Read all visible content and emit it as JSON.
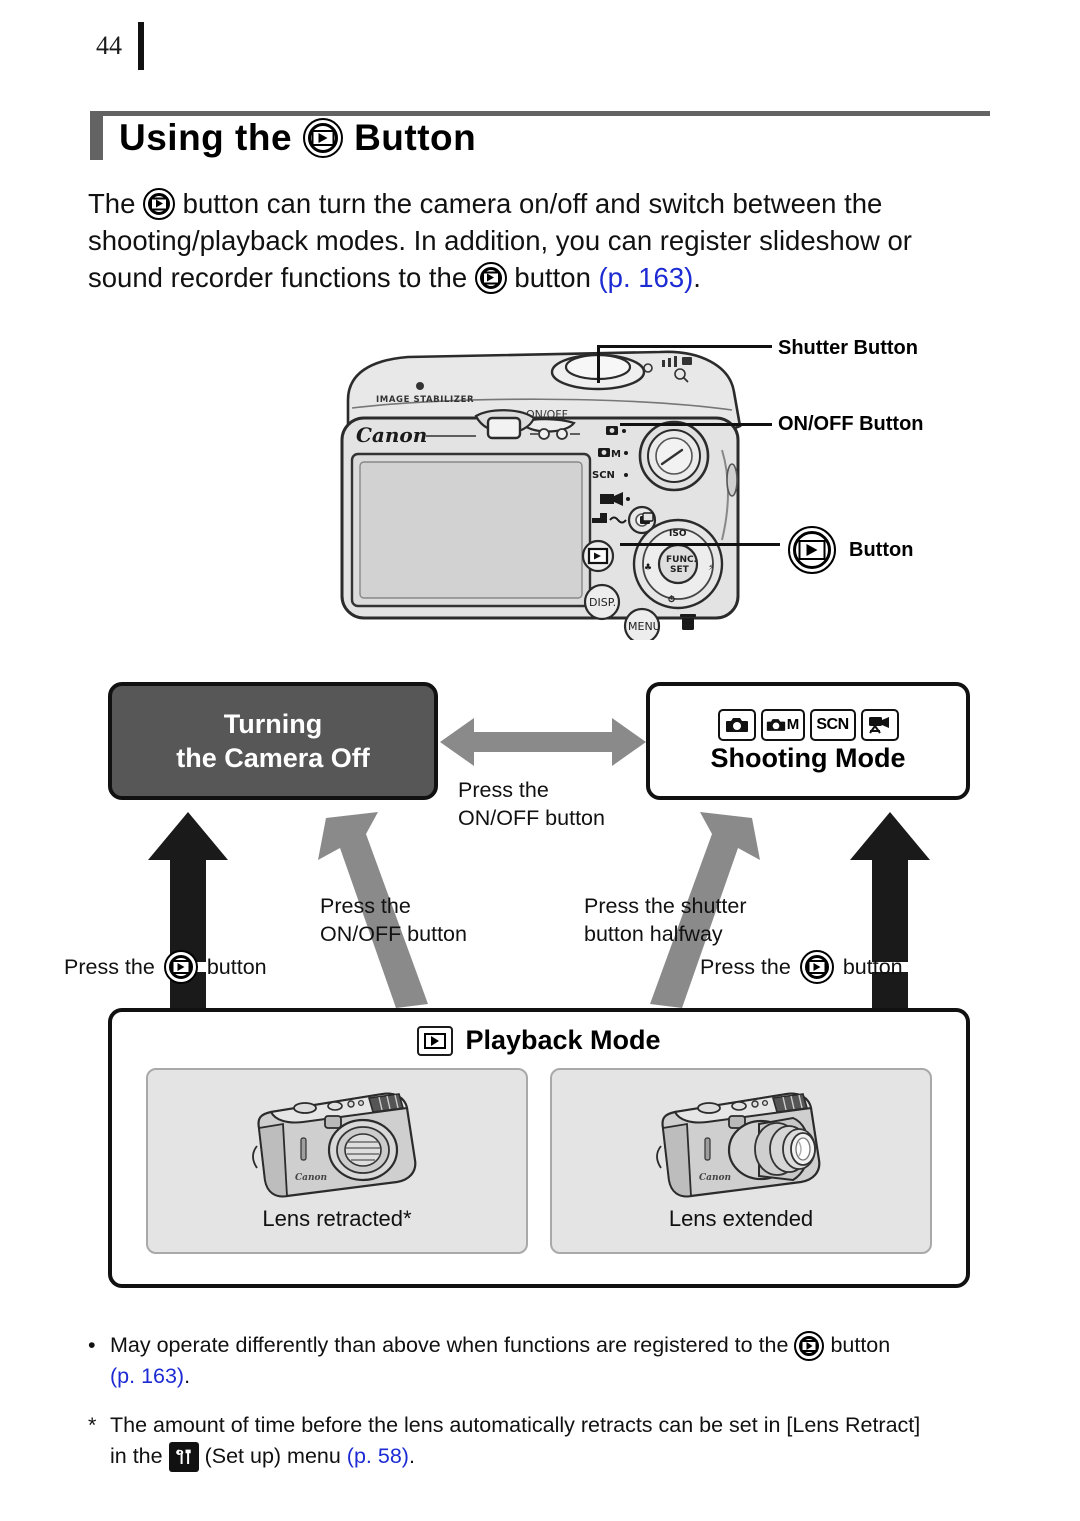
{
  "page": {
    "number": "44"
  },
  "header": {
    "title_before": "Using the",
    "title_after": "Button",
    "icon": "playback-button-icon"
  },
  "intro": {
    "line1_a": "The",
    "line1_b": "button can turn the camera on/off and switch between the",
    "line2": "shooting/playback modes. In addition, you can register slideshow or",
    "line3_a": "sound recorder functions to the",
    "line3_b": "button",
    "line3_ref": "(p. 163)",
    "line3_end": "."
  },
  "camera_figure": {
    "brand": "Canon",
    "stabilizer": "IMAGE STABILIZER",
    "onoff_text": "ON/OFF",
    "dial_labels": [
      "SCN"
    ],
    "disp_label": "DISP.",
    "menu_label": "MENU",
    "func_label": "FUNC.",
    "set_label": "SET",
    "callouts": [
      {
        "label": "Shutter Button"
      },
      {
        "label": "ON/OFF Button"
      },
      {
        "label": "Button",
        "icon": "playback-button-icon"
      }
    ]
  },
  "flow": {
    "off_box": {
      "line1": "Turning",
      "line2": "the Camera Off"
    },
    "shooting_box": {
      "label": "Shooting Mode",
      "mode_icons": [
        "camera-auto-icon",
        "camera-manual-icon",
        "scn-icon",
        "movie-icon"
      ],
      "scn_text": "SCN",
      "manual_text": "M"
    },
    "playback_box": {
      "label": "Playback Mode",
      "icon": "playback-square-icon",
      "panels": [
        {
          "caption": "Lens retracted*",
          "image": "camera-lens-retracted"
        },
        {
          "caption": "Lens extended",
          "image": "camera-lens-extended"
        }
      ]
    },
    "labels": {
      "center_top": {
        "line1": "Press the",
        "line2": "ON/OFF button"
      },
      "left_mid": {
        "line1": "Press the",
        "line2": "ON/OFF button"
      },
      "right_mid": {
        "line1": "Press the shutter",
        "line2": "button halfway"
      },
      "left_bottom": {
        "before": "Press the",
        "after": "button"
      },
      "right_bottom": {
        "before": "Press the",
        "after": "button"
      }
    }
  },
  "notes": [
    {
      "mark": "•",
      "text_a": "May operate differently than above when functions are registered to the",
      "text_b": "button",
      "line2_ref": "(p. 163)",
      "line2_end": "."
    },
    {
      "mark": "*",
      "text_a": "The amount of time before the lens automatically retracts can be set in [Lens Retract]",
      "line2_a": "in the",
      "line2_b": "(Set up) menu",
      "line2_ref": "(p. 58)",
      "line2_end": "."
    }
  ],
  "colors": {
    "box_dark": "#575757",
    "panel_gray": "#e4e4e4",
    "arrow_gray": "#8a8a8a",
    "arrow_black": "#1a1a1a",
    "ref_blue": "#1d2bd4",
    "rule_gray": "#636363"
  }
}
